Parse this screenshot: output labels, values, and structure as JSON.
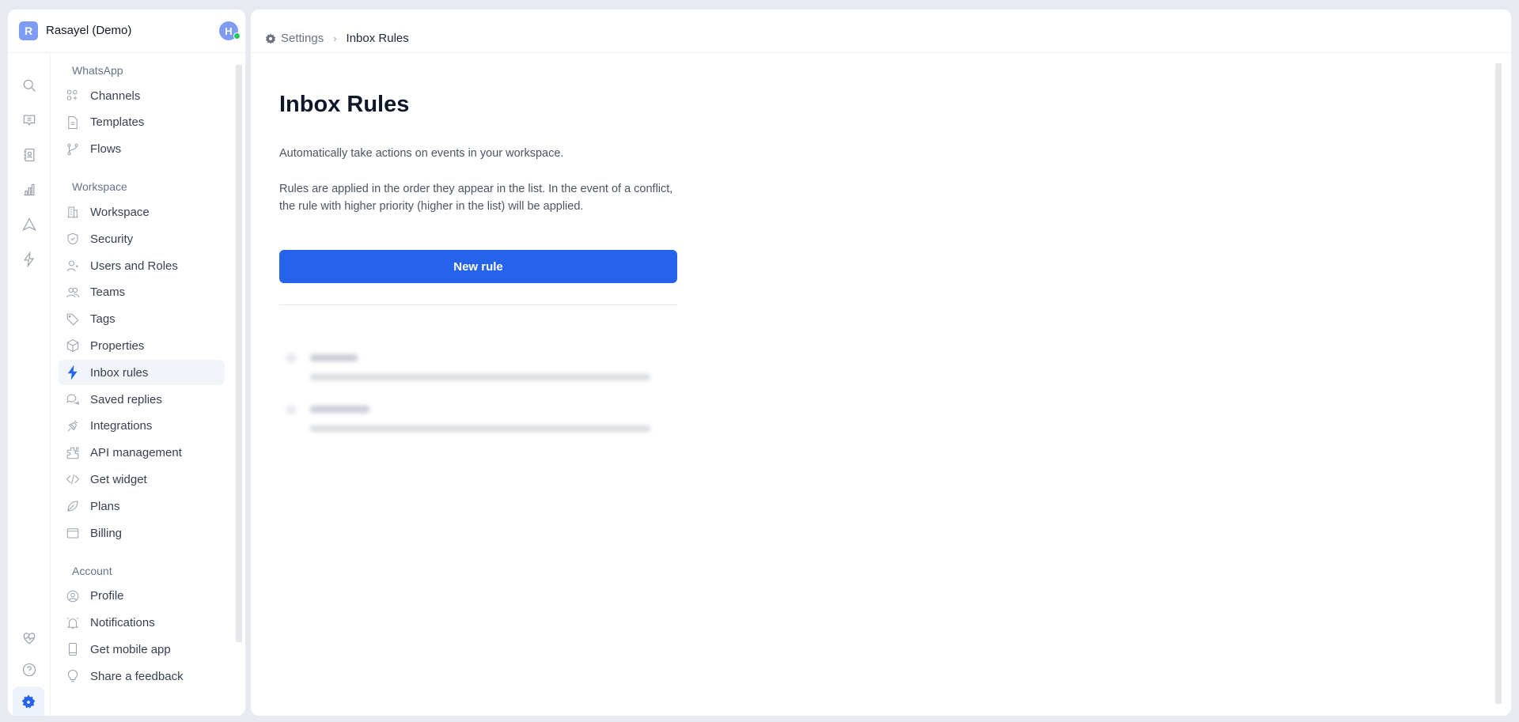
{
  "workspace": {
    "badge": "R",
    "name": "Rasayel (Demo)",
    "avatar": "H"
  },
  "rail": [
    "search-icon",
    "chat-icon",
    "contacts-icon",
    "reports-icon",
    "broadcast-icon",
    "automation-icon",
    "health-icon",
    "help-icon",
    "settings-icon"
  ],
  "nav": {
    "sections": [
      {
        "title": "WhatsApp",
        "items": [
          "Channels",
          "Templates",
          "Flows"
        ]
      },
      {
        "title": "Workspace",
        "items": [
          "Workspace",
          "Security",
          "Users and Roles",
          "Teams",
          "Tags",
          "Properties",
          "Inbox rules",
          "Saved replies",
          "Integrations",
          "API management",
          "Get widget",
          "Plans",
          "Billing"
        ]
      },
      {
        "title": "Account",
        "items": [
          "Profile",
          "Notifications",
          "Get mobile app",
          "Share a feedback"
        ]
      }
    ],
    "active": "Inbox rules"
  },
  "breadcrumb": {
    "parent": "Settings",
    "current": "Inbox Rules"
  },
  "main": {
    "title": "Inbox Rules",
    "desc1": "Automatically take actions on events in your workspace.",
    "desc2": "Rules are applied in the order they appear in the list. In the event of a conflict, the rule with higher priority (higher in the list) will be applied.",
    "new_rule": "New rule"
  },
  "colors": {
    "accent": "#2563eb",
    "status_online": "#22c55e"
  }
}
